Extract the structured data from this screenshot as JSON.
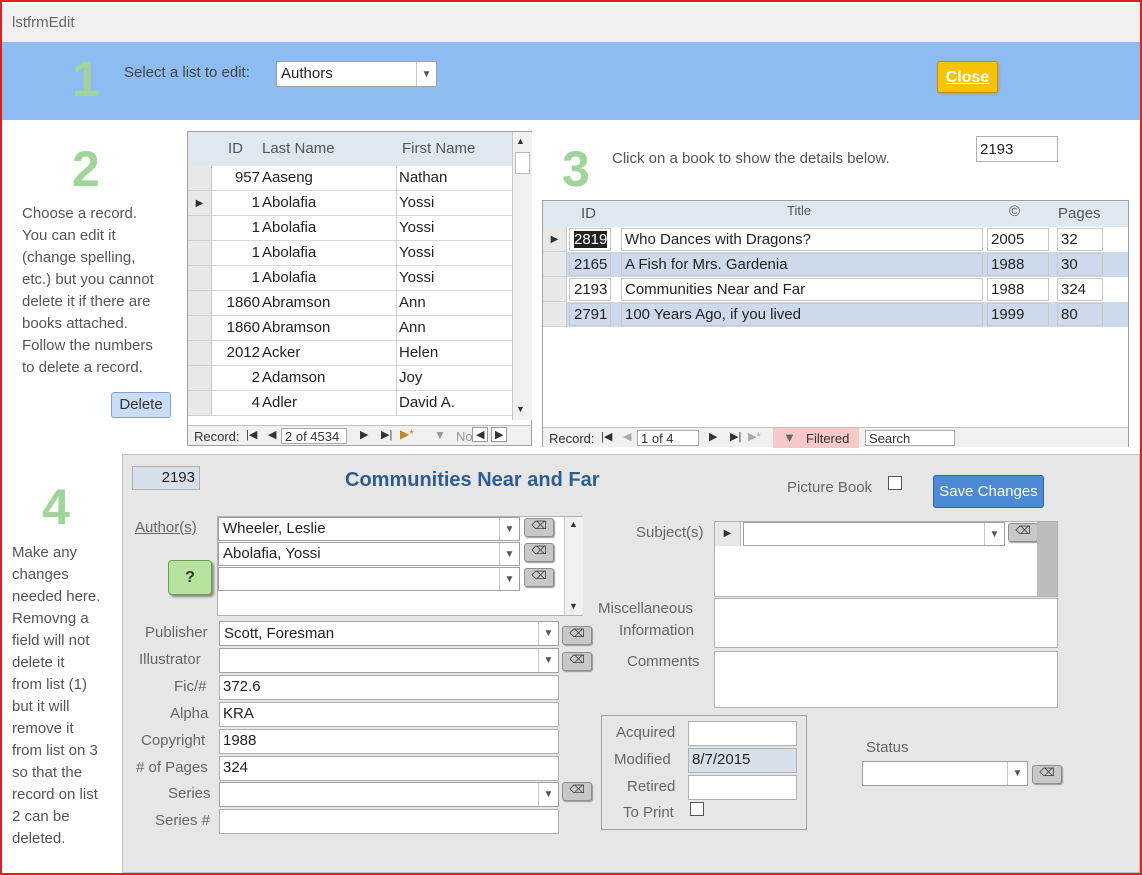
{
  "window": {
    "title": "lstfrmEdit"
  },
  "header": {
    "step": "1",
    "select_label": "Select a list to edit:",
    "list_value": "Authors",
    "close_label": "Close"
  },
  "section2": {
    "step": "2",
    "instructions": [
      "Choose a record.",
      "You can edit it",
      "(change spelling,",
      "etc.) but you cannot",
      "delete it if there are",
      "books attached.",
      "Follow the numbers",
      "to delete a record."
    ],
    "delete_label": "Delete",
    "columns": [
      "ID",
      "Last Name",
      "First Name"
    ],
    "rows": [
      {
        "id": "957",
        "last": "Aaseng",
        "first": "Nathan"
      },
      {
        "id": "1",
        "last": "Abolafia",
        "first": "Yossi"
      },
      {
        "id": "1",
        "last": "Abolafia",
        "first": "Yossi"
      },
      {
        "id": "1",
        "last": "Abolafia",
        "first": "Yossi"
      },
      {
        "id": "1",
        "last": "Abolafia",
        "first": "Yossi"
      },
      {
        "id": "1860",
        "last": "Abramson",
        "first": "Ann"
      },
      {
        "id": "1860",
        "last": "Abramson",
        "first": "Ann"
      },
      {
        "id": "2012",
        "last": "Acker",
        "first": "Helen"
      },
      {
        "id": "2",
        "last": "Adamson",
        "first": "Joy"
      },
      {
        "id": "4",
        "last": "Adler",
        "first": "David A."
      }
    ],
    "nav": {
      "label": "Record:",
      "position": "2 of 4534",
      "filter": "No"
    }
  },
  "section3": {
    "step": "3",
    "instruction": "Click on a book to show the details below.",
    "selected_id": "2193",
    "columns": [
      "ID",
      "Title",
      "©",
      "Pages"
    ],
    "rows": [
      {
        "id": "2819",
        "title": "Who Dances with Dragons?",
        "year": "2005",
        "pages": "32"
      },
      {
        "id": "2165",
        "title": "A Fish for Mrs. Gardenia",
        "year": "1988",
        "pages": "30"
      },
      {
        "id": "2193",
        "title": "Communities Near and Far",
        "year": "1988",
        "pages": "324"
      },
      {
        "id": "2791",
        "title": "100 Years Ago, if you lived",
        "year": "1999",
        "pages": "80"
      }
    ],
    "nav": {
      "label": "Record:",
      "position": "1 of 4",
      "filtered": "Filtered",
      "search": "Search"
    }
  },
  "section4": {
    "step": "4",
    "instructions": [
      "Make any",
      "changes",
      "needed here.",
      "Removng a",
      "field will not",
      "delete it",
      "from list (1)",
      "but it will",
      "remove it",
      "from list on 3",
      "so that the",
      "record on list",
      "2 can be",
      "deleted."
    ],
    "book_id": "2193",
    "book_title": "Communities Near and Far",
    "picture_book_label": "Picture Book",
    "save_label": "Save Changes",
    "authors_label": "Author(s)",
    "authors": [
      "Wheeler, Leslie",
      "Abolafia, Yossi",
      ""
    ],
    "help_label": "?",
    "subjects_label": "Subject(s)",
    "misc_label_1": "Miscellaneous",
    "misc_label_2": "Information",
    "comments_label": "Comments",
    "publisher_label": "Publisher",
    "publisher": "Scott, Foresman",
    "illustrator_label": "Illustrator",
    "illustrator": "",
    "fic_label": "Fic/#",
    "fic": "372.6",
    "alpha_label": "Alpha",
    "alpha": "KRA",
    "copyright_label": "Copyright",
    "copyright": "1988",
    "pages_label": "# of Pages",
    "pages": "324",
    "series_label": "Series",
    "series": "",
    "series_num_label": "Series #",
    "series_num": "",
    "acquired_label": "Acquired",
    "acquired": "",
    "modified_label": "Modified",
    "modified": "8/7/2015",
    "retired_label": "Retired",
    "retired": "",
    "to_print_label": "To Print",
    "status_label": "Status",
    "status": ""
  }
}
